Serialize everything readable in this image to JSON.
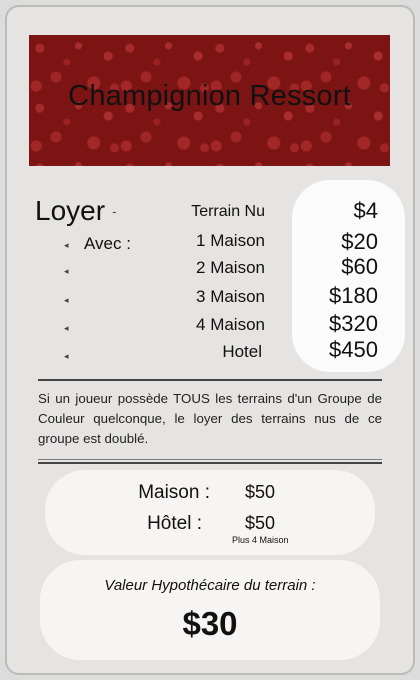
{
  "card": {
    "title": "Champignion Ressort",
    "colors": {
      "header": "#7d1414",
      "card": "#e6e4e2"
    },
    "rent": {
      "heading": "Loyer",
      "dash": "-",
      "with_label": "Avec :",
      "bullet": "◂",
      "rows": [
        {
          "label": "Terrain Nu",
          "price": "$4"
        },
        {
          "label": "1 Maison",
          "price": "$20"
        },
        {
          "label": "2 Maison",
          "price": "$60"
        },
        {
          "label": "3 Maison",
          "price": "$180"
        },
        {
          "label": "4 Maison",
          "price": "$320"
        },
        {
          "label": "Hotel",
          "price": "$450"
        }
      ]
    },
    "rule_text": "Si un joueur possède TOUS les terrains d'un Groupe de Couleur quelconque, le loyer des terrains nus de ce groupe est doublé.",
    "building_costs": {
      "house_label": "Maison :",
      "house_price": "$50",
      "hotel_label": "Hôtel :",
      "hotel_price": "$50",
      "hotel_note": "Plus 4 Maison"
    },
    "mortgage": {
      "label": "Valeur Hypothécaire du terrain :",
      "value": "$30"
    }
  }
}
